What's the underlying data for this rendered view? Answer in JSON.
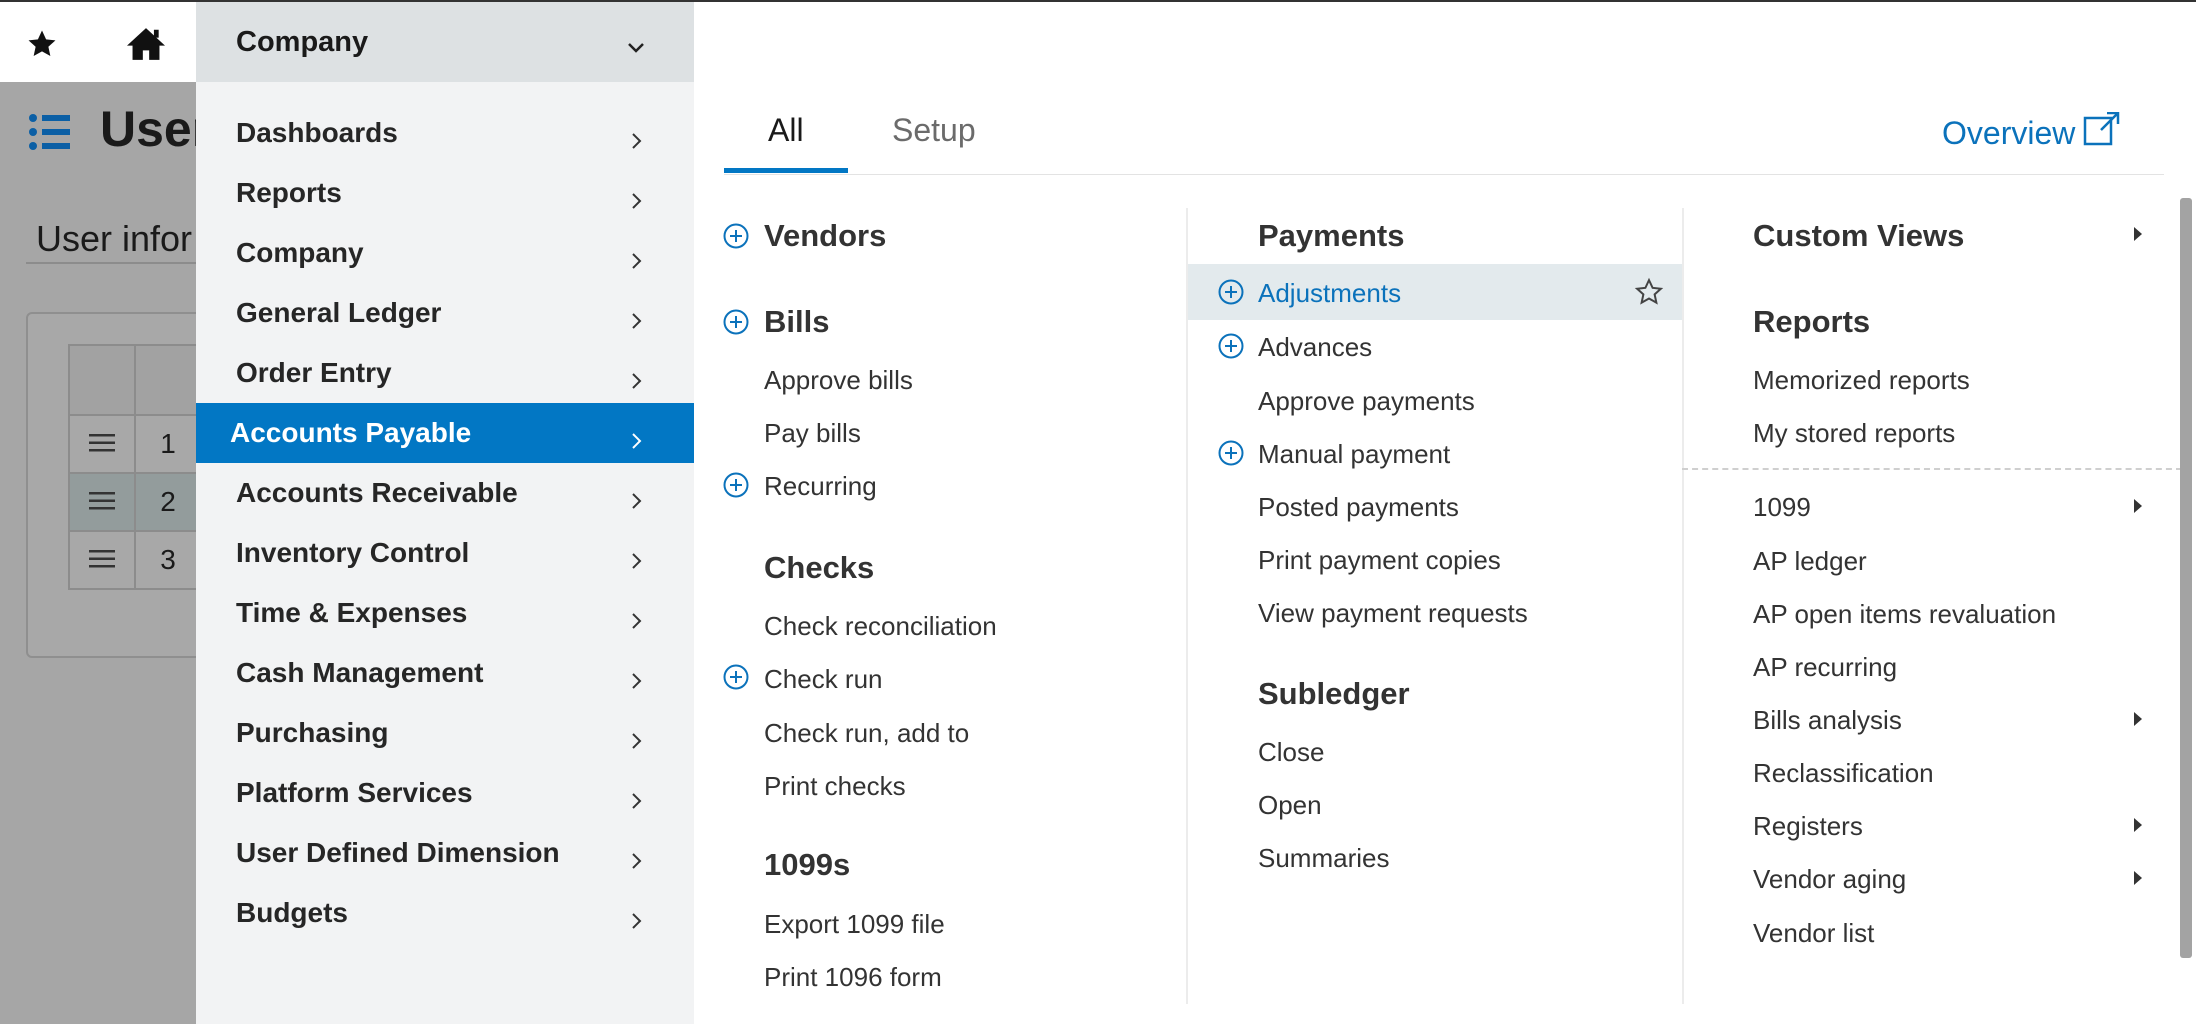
{
  "background": {
    "page_title": "User",
    "section_title": "User infor",
    "rows": [
      "1",
      "2",
      "3"
    ]
  },
  "left_menu": {
    "selected_app": "Company",
    "items": [
      {
        "label": "Dashboards"
      },
      {
        "label": "Reports"
      },
      {
        "label": "Company"
      },
      {
        "label": "General Ledger"
      },
      {
        "label": "Order Entry"
      },
      {
        "label": "Accounts Payable",
        "active": true
      },
      {
        "label": "Accounts Receivable"
      },
      {
        "label": "Inventory Control"
      },
      {
        "label": "Time & Expenses"
      },
      {
        "label": "Cash Management"
      },
      {
        "label": "Purchasing"
      },
      {
        "label": "Platform Services"
      },
      {
        "label": "User Defined Dimension"
      },
      {
        "label": "Budgets"
      }
    ]
  },
  "panel": {
    "tabs": [
      "All",
      "Setup"
    ],
    "active_tab": "All",
    "overview_link": "Overview",
    "col1": {
      "vendors": "Vendors",
      "bills": "Bills",
      "approve_bills": "Approve bills",
      "pay_bills": "Pay bills",
      "recurring": "Recurring",
      "checks": "Checks",
      "check_reconciliation": "Check reconciliation",
      "check_run": "Check run",
      "check_run_add_to": "Check run, add to",
      "print_checks": "Print checks",
      "forms_1099s": "1099s",
      "export_1099": "Export 1099 file",
      "print_1096": "Print 1096 form"
    },
    "col2": {
      "payments": "Payments",
      "adjustments": "Adjustments",
      "advances": "Advances",
      "approve_payments": "Approve payments",
      "manual_payment": "Manual payment",
      "posted_payments": "Posted payments",
      "print_payment_copies": "Print payment copies",
      "view_payment_requests": "View payment requests",
      "subledger": "Subledger",
      "close": "Close",
      "open": "Open",
      "summaries": "Summaries"
    },
    "col3": {
      "custom_views": "Custom Views",
      "reports": "Reports",
      "memorized_reports": "Memorized reports",
      "my_stored_reports": "My stored reports",
      "r1099": "1099",
      "ap_ledger": "AP ledger",
      "ap_open_items": "AP open items revaluation",
      "ap_recurring": "AP recurring",
      "bills_analysis": "Bills analysis",
      "reclassification": "Reclassification",
      "registers": "Registers",
      "vendor_aging": "Vendor aging",
      "vendor_list": "Vendor list"
    }
  },
  "colors": {
    "accent": "#0277c4",
    "link": "#0b72bb",
    "menu_bg": "#f2f3f4"
  },
  "icons": [
    "star-icon",
    "home-icon",
    "list-icon",
    "chevron-down-icon",
    "chevron-right-icon",
    "plus-circle-icon",
    "external-link-icon",
    "caret-right-icon"
  ]
}
